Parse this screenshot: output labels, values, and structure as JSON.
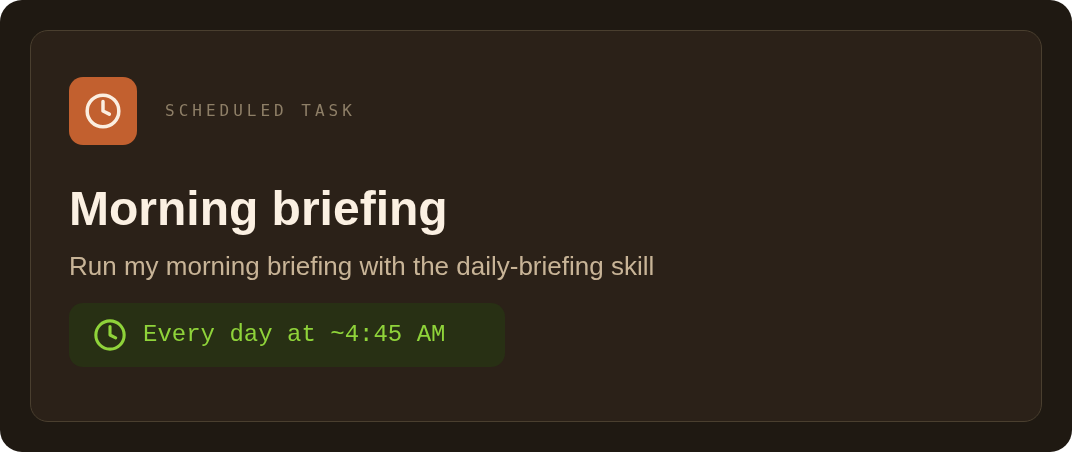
{
  "card": {
    "kind_label": "SCHEDULED TASK",
    "title": "Morning briefing",
    "description": "Run my morning briefing with the daily-briefing skill",
    "schedule": "Every day at ~4:45 AM"
  }
}
